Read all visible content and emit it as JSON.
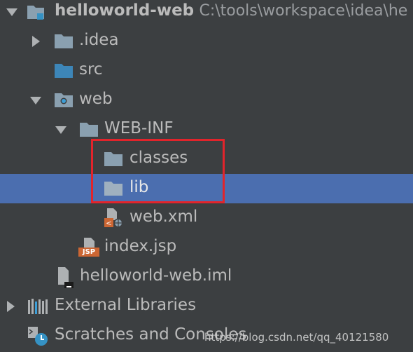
{
  "tree": {
    "root": {
      "name": "helloworld-web",
      "path": "C:\\tools\\workspace\\idea\\he",
      "icon": "module-folder-icon"
    },
    "items": [
      {
        "label": ".idea",
        "icon": "folder-icon"
      },
      {
        "label": "src",
        "icon": "source-folder-icon"
      },
      {
        "label": "web",
        "icon": "web-folder-icon"
      },
      {
        "label": "WEB-INF",
        "icon": "folder-icon"
      },
      {
        "label": "classes",
        "icon": "folder-icon"
      },
      {
        "label": "lib",
        "icon": "folder-icon",
        "selected": true
      },
      {
        "label": "web.xml",
        "icon": "xml-file-icon"
      },
      {
        "label": "index.jsp",
        "icon": "jsp-file-icon"
      },
      {
        "label": "helloworld-web.iml",
        "icon": "iml-file-icon"
      },
      {
        "label": "External Libraries",
        "icon": "libraries-icon"
      },
      {
        "label": "Scratches and Consoles",
        "icon": "scratches-icon"
      }
    ],
    "jsp_badge": "JSP"
  },
  "watermark": "https://blog.csdn.net/qq_40121580",
  "colors": {
    "background": "#3c3f41",
    "selection": "#4b6eaf",
    "highlight_box": "#e2242b",
    "folder": "#8aa0b0",
    "source_folder": "#3d86b8"
  }
}
